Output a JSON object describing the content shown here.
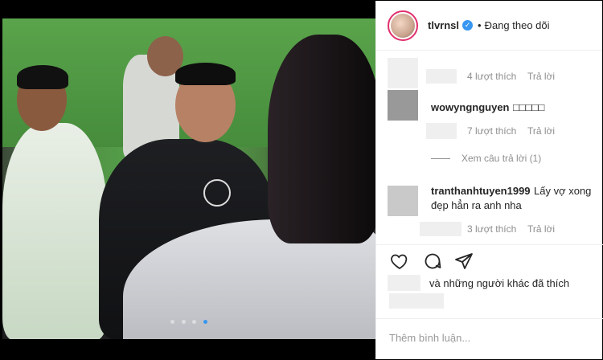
{
  "post": {
    "username": "tlvrnsl",
    "verified_icon": "verified-badge-icon",
    "separator": "•",
    "follow_status": "Đang theo dõi",
    "carousel": {
      "count": 4,
      "active_index": 3
    }
  },
  "comments": [
    {
      "likes": "4 lượt thích",
      "reply": "Trả lời"
    },
    {
      "user": "wowyngnguyen",
      "text": "□□□□□",
      "likes": "7 lượt thích",
      "reply": "Trả lời",
      "view_replies": "Xem câu trả lời (1)"
    },
    {
      "user": "tranthanhtuyen1999",
      "text": "Lấy vợ xong đẹp hẳn ra anh nha",
      "likes": "3 lượt thích",
      "reply": "Trả lời"
    }
  ],
  "actions": {
    "like_icon": "heart-icon",
    "comment_icon": "comment-icon",
    "share_icon": "share-icon"
  },
  "likes_line": "và những người khác đã thích",
  "add_comment": {
    "placeholder": "Thêm bình luận..."
  },
  "colors": {
    "accent": "#3897f0",
    "text": "#262626",
    "muted": "#8e8e8e"
  }
}
